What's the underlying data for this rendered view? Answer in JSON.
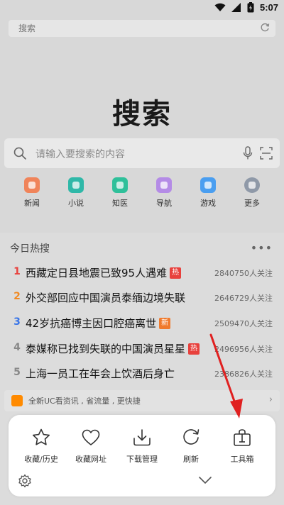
{
  "status_bar": {
    "time": "5:07"
  },
  "url_bar": {
    "placeholder": "搜索"
  },
  "hero": {
    "title": "搜索"
  },
  "search_box": {
    "placeholder": "请输入要搜索的内容"
  },
  "quick_links": [
    {
      "label": "新闻",
      "color": "#f0845a"
    },
    {
      "label": "小说",
      "color": "#2fb8a8"
    },
    {
      "label": "知医",
      "color": "#2fc09a"
    },
    {
      "label": "导航",
      "color": "#b48be6"
    },
    {
      "label": "游戏",
      "color": "#4a9ef0"
    },
    {
      "label": "更多",
      "color": "#8f99a8"
    }
  ],
  "hot_search": {
    "header": "今日热搜",
    "more": "•••",
    "items": [
      {
        "rank": "1",
        "title": "西藏定日县地震已致95人遇难",
        "badge": "热",
        "badge_color": "#e8413d",
        "count": "2840750人关注",
        "rank_color": "#e8413d"
      },
      {
        "rank": "2",
        "title": "外交部回应中国演员泰缅边境失联",
        "badge": "",
        "badge_color": "",
        "count": "2646729人关注",
        "rank_color": "#f08a24"
      },
      {
        "rank": "3",
        "title": "42岁抗癌博主因口腔癌离世",
        "badge": "新",
        "badge_color": "#f07a2c",
        "count": "2509470人关注",
        "rank_color": "#3a76e8"
      },
      {
        "rank": "4",
        "title": "泰媒称已找到失联的中国演员星星",
        "badge": "热",
        "badge_color": "#e8413d",
        "count": "2496956人关注",
        "rank_color": "#888888"
      },
      {
        "rank": "5",
        "title": "上海一员工在年会上饮酒后身亡",
        "badge": "",
        "badge_color": "",
        "count": "2386826人关注",
        "rank_color": "#888888"
      }
    ]
  },
  "promo": {
    "text": "全新UC看资讯 , 省流量 , 更快捷",
    "arrow": "›"
  },
  "tools_menu": [
    {
      "label": "收藏/历史",
      "icon": "star-icon"
    },
    {
      "label": "收藏网址",
      "icon": "heart-icon"
    },
    {
      "label": "下载管理",
      "icon": "download-icon"
    },
    {
      "label": "刷新",
      "icon": "refresh-icon"
    },
    {
      "label": "工具箱",
      "icon": "toolbox-icon"
    }
  ],
  "colors": {
    "annotation_arrow": "#e02020",
    "sheet_bg": "#ffffff",
    "dim_bg": "#d8d8d8"
  }
}
